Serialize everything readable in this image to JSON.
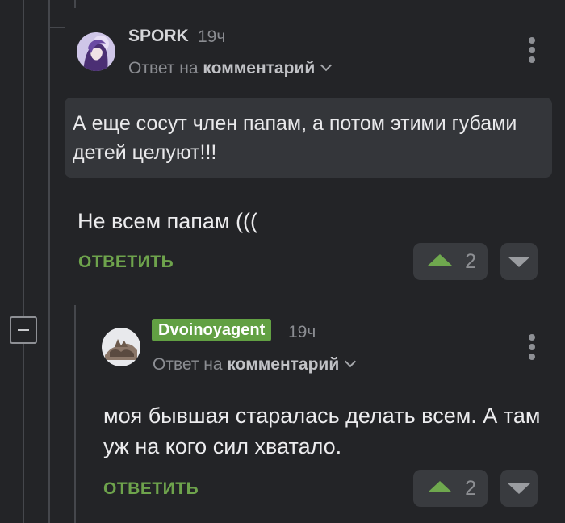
{
  "comment1": {
    "author": "SPORK",
    "time": "19ч",
    "reply_prefix": "Ответ на ",
    "reply_target": "комментарий",
    "quote": "А еще сосут член папам, а потом этими губами детей целуют!!!",
    "text": "Не всем папам (((",
    "reply_label": "ОТВЕТИТЬ",
    "votes": "2"
  },
  "comment2": {
    "author": "Dvoinoyagent",
    "time": "19ч",
    "reply_prefix": "Ответ на ",
    "reply_target": "комментарий",
    "text": "моя бывшая старалась делать всем. А там уж на кого сил хватало.",
    "reply_label": "ОТВЕТИТЬ",
    "votes": "2"
  },
  "colors": {
    "background": "#232427",
    "accent_green": "#6ea34c",
    "author_badge": "#62a043"
  },
  "icons": [
    "collapse-icon",
    "kebab-menu-icon",
    "chevron-down-icon",
    "upvote-icon",
    "downvote-icon"
  ]
}
